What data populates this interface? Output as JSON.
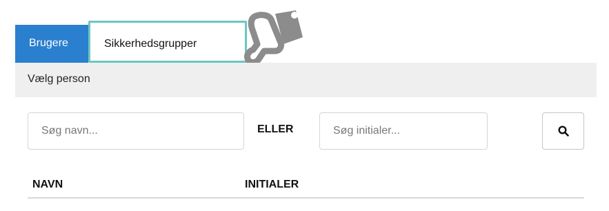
{
  "tabs": [
    {
      "label": "Brugere",
      "active": true
    },
    {
      "label": "Sikkerhedsgrupper",
      "active": false
    }
  ],
  "panel": {
    "title": "Vælg person"
  },
  "search": {
    "name_placeholder": "Søg navn...",
    "or_label": "ELLER",
    "initials_placeholder": "Søg initialer...",
    "button_icon": "search-icon"
  },
  "table": {
    "columns": [
      "NAVN",
      "INITIALER"
    ]
  },
  "colors": {
    "active_tab": "#2a7fcf",
    "highlight_border": "#6cc6c1",
    "header_bar": "#efefef",
    "pointer_icon": "#8c8c8c"
  },
  "icons": {
    "pointer": "hand-pointer-icon"
  }
}
